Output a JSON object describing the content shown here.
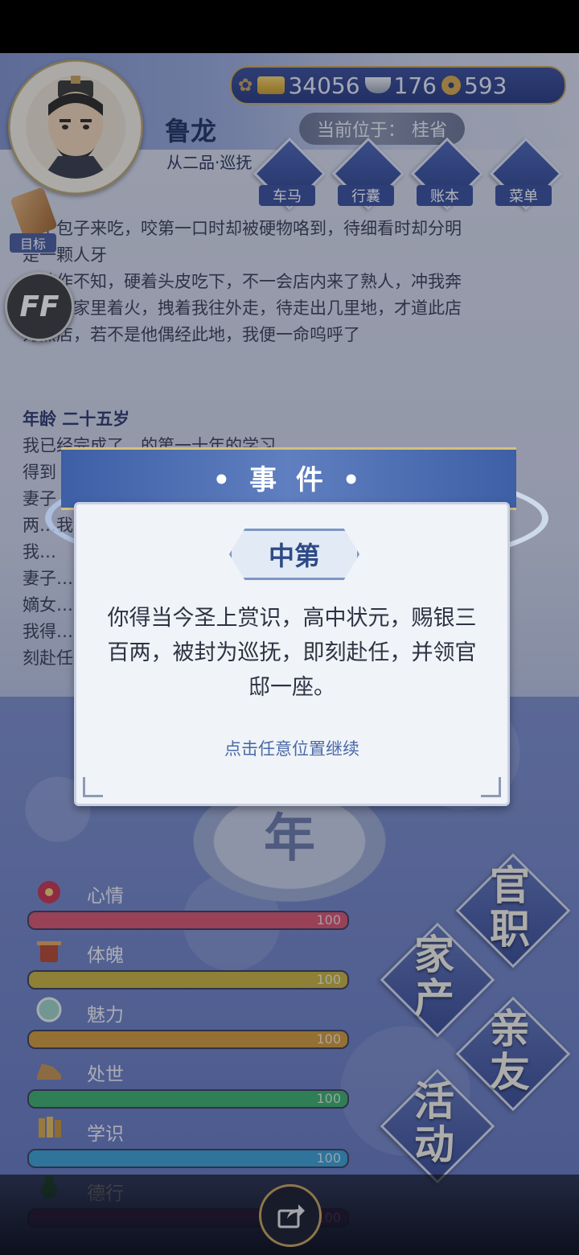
{
  "currency": {
    "gold": "34056",
    "silver": "176",
    "copper": "593"
  },
  "character": {
    "name": "鲁龙",
    "title": "从二品·巡抚",
    "location_label": "当前位于：",
    "location": "桂省"
  },
  "nav": [
    {
      "label": "车马",
      "icon": "carriage-icon"
    },
    {
      "label": "行囊",
      "icon": "bag-icon"
    },
    {
      "label": "账本",
      "icon": "ledger-icon"
    },
    {
      "label": "菜单",
      "icon": "menu-icon"
    }
  ],
  "target_label": "目标",
  "ff_label": "FF",
  "story": {
    "lines": [
      "…了包子来吃，咬第一口时却被硬物咯到，待细看时却分明",
      "是一颗人牙",
      "…装作不知，硬着头皮吃下，不一会店内来了熟人，冲我奔",
      "…只道家里着火，拽着我往外走，待走出几里地，才道此店",
      "为黑店，若不是他偶经此地，我便一命呜呼了"
    ],
    "age": "年龄 二十五岁",
    "lines2": [
      "我已经完成了…的第一十年的学习",
      "得到",
      "妻子",
      "两…我",
      "我…",
      "妻子…",
      "嫡女…",
      "我得…",
      "刻赴任"
    ]
  },
  "event": {
    "header": "• 事 件 •",
    "name": "中第",
    "desc": "你得当今圣上赏识，高中状元，赐银三百两，被封为巡抚，即刻赴任，并领官邸一座。",
    "continue": "点击任意位置继续"
  },
  "year_char": "年",
  "stats": [
    {
      "name": "心情",
      "value": "100",
      "color": "#d8546e",
      "icon": "flower-icon"
    },
    {
      "name": "体魄",
      "value": "100",
      "color": "#c9b23e",
      "icon": "drum-icon"
    },
    {
      "name": "魅力",
      "value": "100",
      "color": "#d39a3a",
      "icon": "jade-icon"
    },
    {
      "name": "处世",
      "value": "100",
      "color": "#3fae6a",
      "icon": "shoe-icon"
    },
    {
      "name": "学识",
      "value": "100",
      "color": "#3d9fd0",
      "icon": "books-icon"
    },
    {
      "name": "德行",
      "value": "100",
      "color": "#7a3d8f",
      "icon": "gourd-icon"
    }
  ],
  "actions": {
    "official": [
      "官",
      "职"
    ],
    "estate": [
      "家",
      "产"
    ],
    "family": [
      "亲",
      "友"
    ],
    "activity": [
      "活",
      "动"
    ]
  }
}
